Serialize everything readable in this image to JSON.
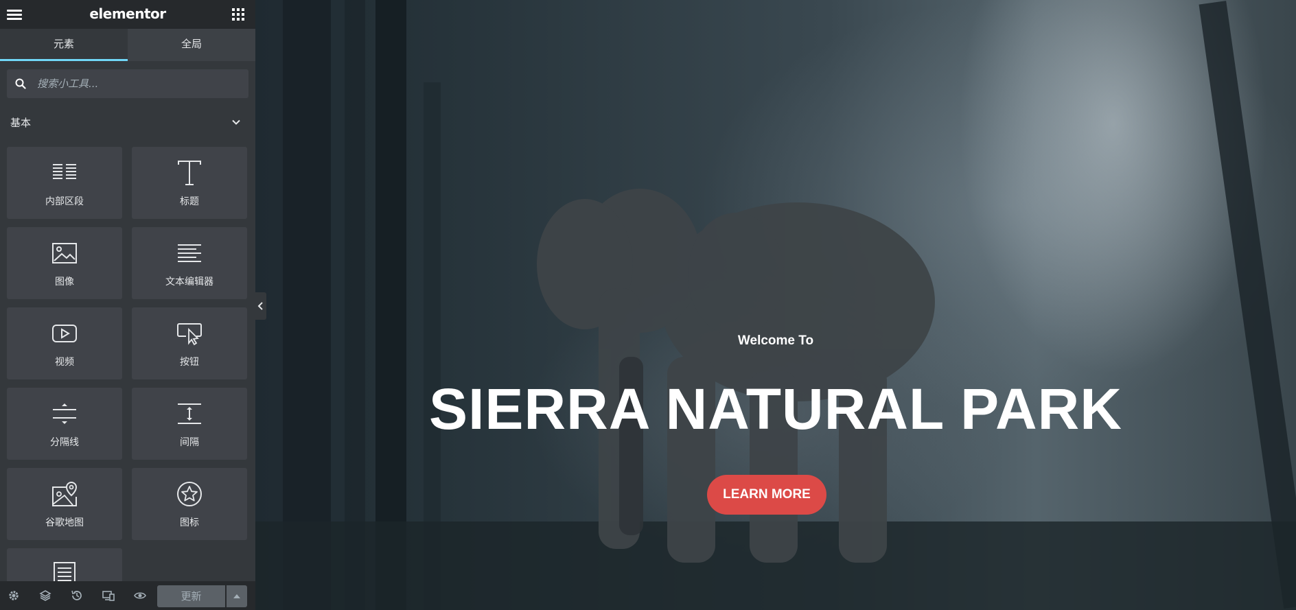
{
  "panel": {
    "logo": "elementor",
    "tabs": [
      {
        "label": "元素",
        "active": true
      },
      {
        "label": "全局",
        "active": false
      }
    ],
    "search": {
      "placeholder": "搜索小工具...",
      "value": ""
    },
    "category": {
      "label": "基本",
      "expanded": true
    },
    "widgets": [
      {
        "label": "内部区段",
        "icon": "inner-section-icon"
      },
      {
        "label": "标题",
        "icon": "heading-icon"
      },
      {
        "label": "图像",
        "icon": "image-icon"
      },
      {
        "label": "文本编辑器",
        "icon": "text-editor-icon"
      },
      {
        "label": "视频",
        "icon": "video-icon"
      },
      {
        "label": "按钮",
        "icon": "button-icon"
      },
      {
        "label": "分隔线",
        "icon": "divider-icon"
      },
      {
        "label": "间隔",
        "icon": "spacer-icon"
      },
      {
        "label": "谷歌地图",
        "icon": "google-maps-icon"
      },
      {
        "label": "图标",
        "icon": "icon-widget-icon"
      },
      {
        "label": "",
        "icon": "icon-list-icon"
      }
    ],
    "footer": {
      "icons": [
        "settings-icon",
        "navigator-icon",
        "history-icon",
        "responsive-icon",
        "preview-eye-icon"
      ],
      "update_label": "更新"
    }
  },
  "hero": {
    "subtitle": "Welcome To",
    "title": "SIERRA NATURAL PARK",
    "button_label": "LEARN MORE",
    "button_color": "#dc4a47"
  },
  "colors": {
    "panel_bg": "#34383c",
    "panel_header": "#26292c",
    "tab_active_underline": "#71d7f7"
  }
}
